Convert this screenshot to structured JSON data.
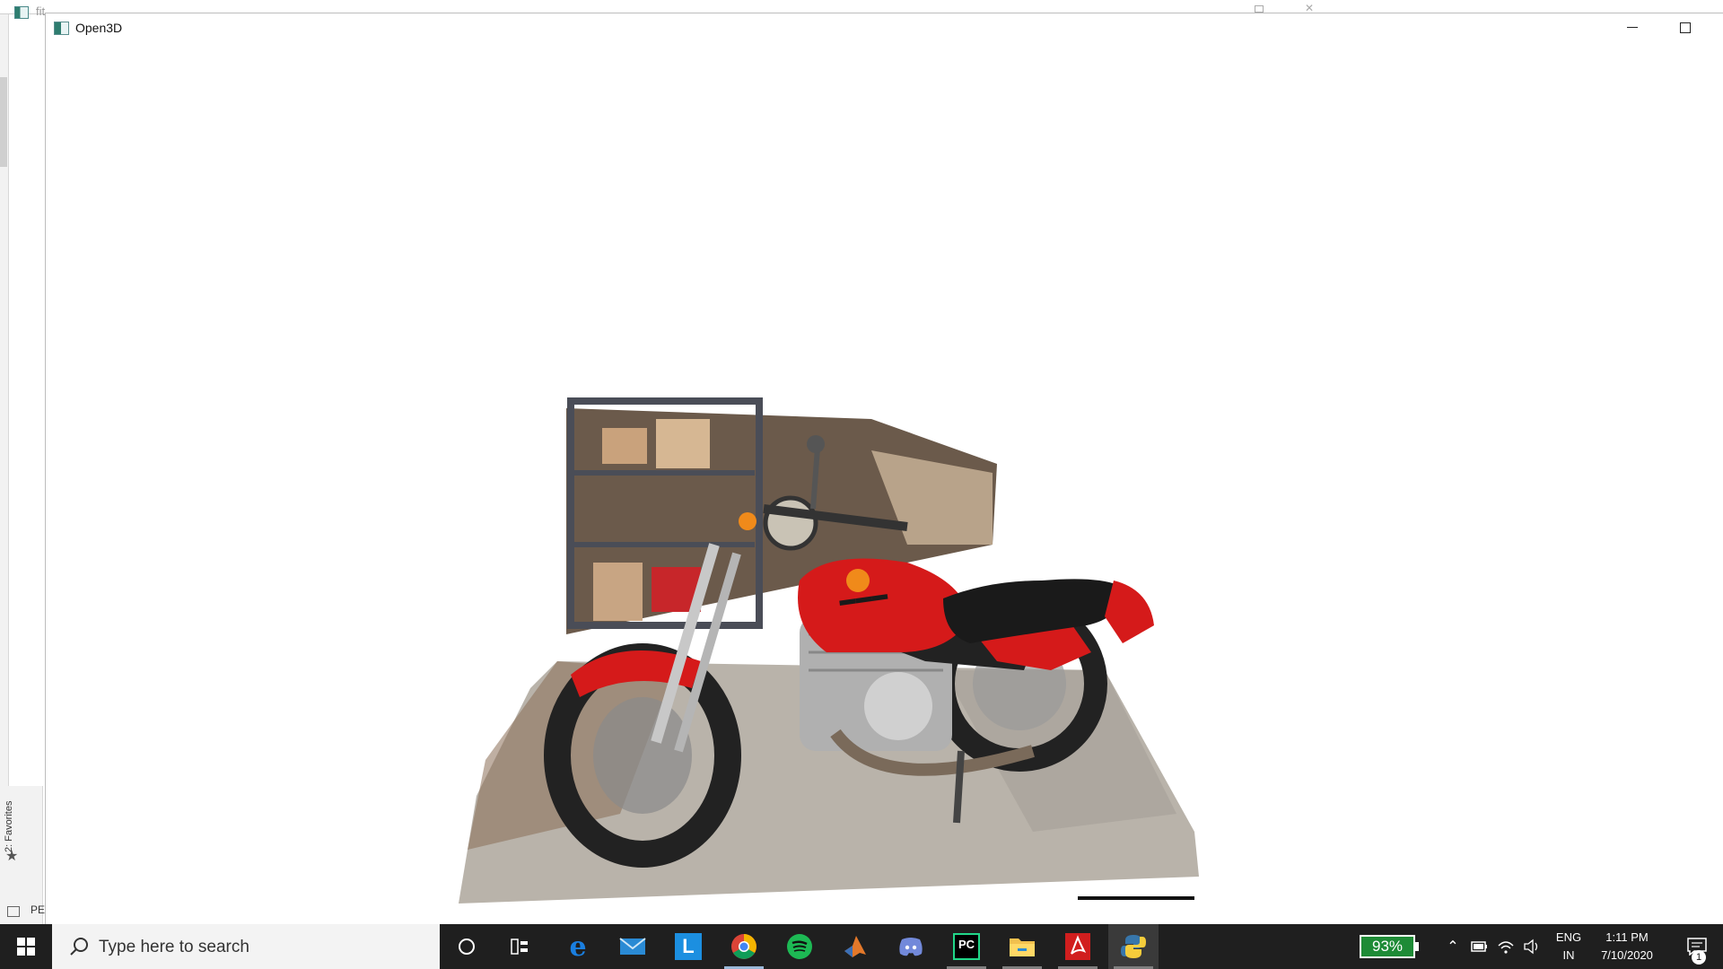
{
  "background_window": {
    "title": "fit",
    "favorites_label": "2: Favorites",
    "bottom_label": "PE"
  },
  "open3d_window": {
    "title": "Open3D"
  },
  "taskbar": {
    "search_placeholder": "Type here to search",
    "apps": [
      {
        "name": "edge",
        "label": "e"
      },
      {
        "name": "mail",
        "label": "mail"
      },
      {
        "name": "lync",
        "label": "L"
      },
      {
        "name": "chrome",
        "label": "chrome"
      },
      {
        "name": "spotify",
        "label": "spotify"
      },
      {
        "name": "matlab",
        "label": "matlab"
      },
      {
        "name": "discord",
        "label": "discord"
      },
      {
        "name": "pycharm",
        "label": "PC"
      },
      {
        "name": "file-explorer",
        "label": "explorer"
      },
      {
        "name": "acrobat",
        "label": "acrobat"
      },
      {
        "name": "python",
        "label": "python"
      }
    ],
    "battery_percent": "93%",
    "language_line1": "ENG",
    "language_line2": "IN",
    "time": "1:11 PM",
    "date": "7/10/2020",
    "notification_count": "1"
  },
  "colors": {
    "taskbar_bg": "#1f1f1f",
    "battery_green": "#1e8b36",
    "bike_red": "#d51a1a"
  }
}
